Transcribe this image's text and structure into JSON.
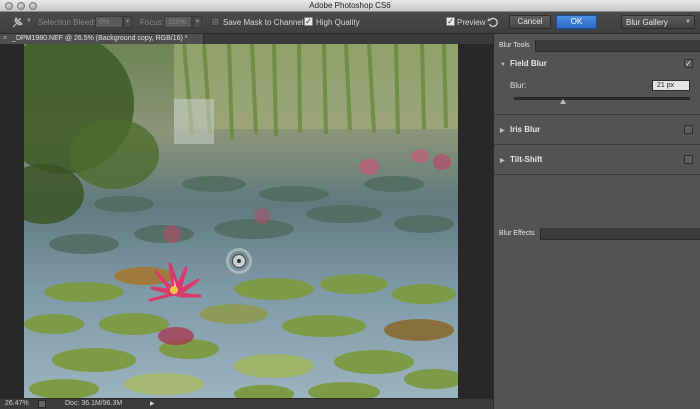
{
  "window": {
    "title": "Adobe Photoshop CS6"
  },
  "options_bar": {
    "selection_bleed_label": "Selection Bleed:",
    "selection_bleed_value": "0%",
    "focus_label": "Focus:",
    "focus_value": "100%",
    "save_mask_label": "Save Mask to Channels",
    "high_quality_label": "High Quality",
    "high_quality_checked": true,
    "preview_label": "Preview",
    "preview_checked": true,
    "cancel_label": "Cancel",
    "ok_label": "OK",
    "gallery_label": "Blur Gallery"
  },
  "document": {
    "tab_label": "_DPM1980.NEF @ 26.5% (Background copy, RGB/16) *",
    "close_glyph": "×"
  },
  "status": {
    "zoom": "26.47%",
    "doc_info": "Doc: 36.1M/96.3M"
  },
  "panels": {
    "blur_tools_tab": "Blur Tools",
    "field_blur": {
      "label": "Field Blur",
      "checked": true,
      "expanded": true,
      "blur_label": "Blur:",
      "blur_value": "21 px"
    },
    "iris_blur": {
      "label": "Iris Blur",
      "checked": false
    },
    "tilt_shift": {
      "label": "Tilt-Shift",
      "checked": false
    },
    "blur_effects_tab": "Blur Effects"
  },
  "colors": {
    "ok_button": "#2b6cc6",
    "panel_bg": "#535353",
    "canvas_bg": "#282828"
  },
  "icons": [
    "pin-icon",
    "reset-icon",
    "chevron-down-icon",
    "checkmark-icon",
    "disclosure-triangle-icon",
    "blur-pin-icon"
  ]
}
